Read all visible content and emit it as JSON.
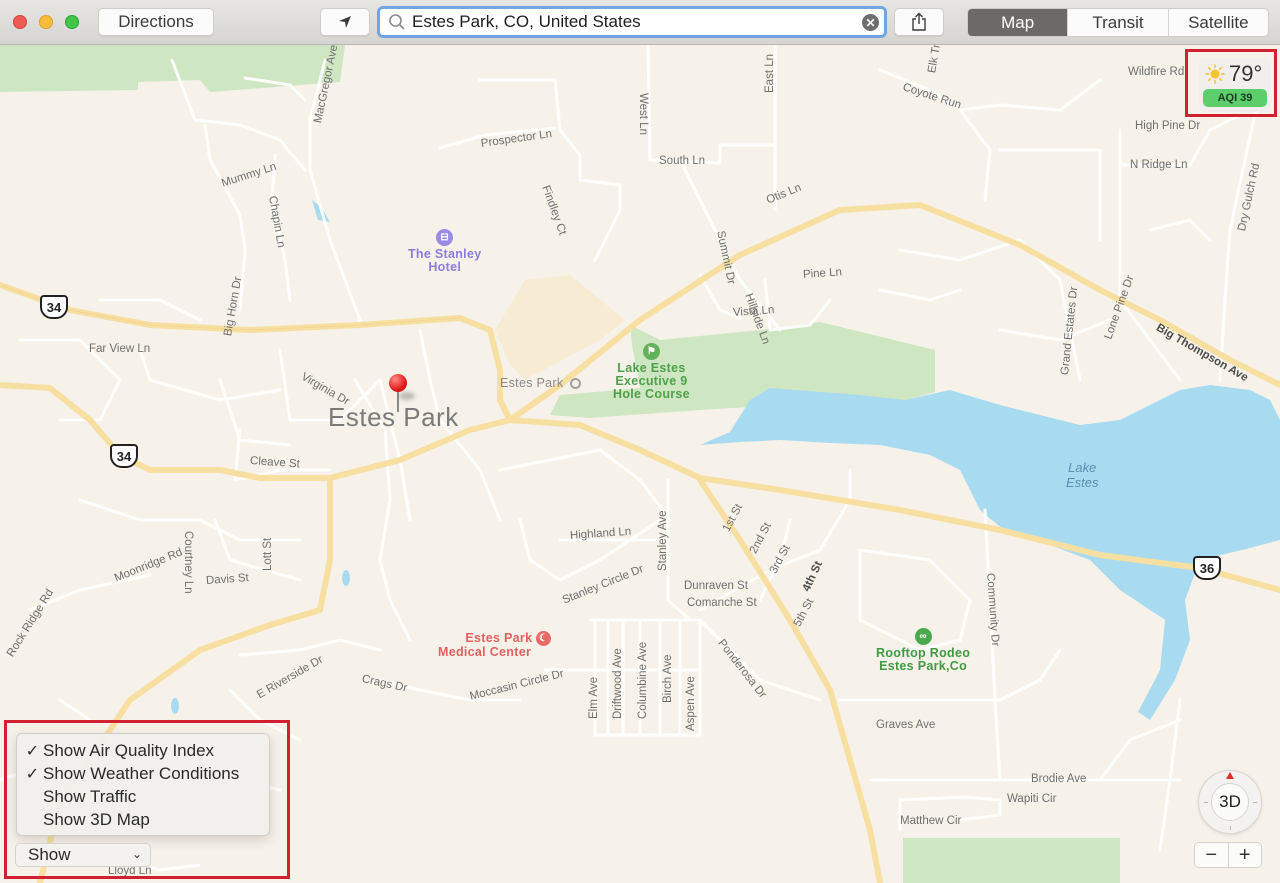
{
  "window": {
    "controls": [
      "close",
      "minimize",
      "maximize"
    ]
  },
  "toolbar": {
    "directions_label": "Directions",
    "locate_icon": "location-arrow-icon",
    "search": {
      "value": "Estes Park, CO, United States",
      "icon": "search-icon",
      "clear_icon": "clear-icon",
      "clear_glyph": "✕"
    },
    "share_icon": "share-icon",
    "map_modes": [
      {
        "label": "Map",
        "active": true
      },
      {
        "label": "Transit",
        "active": false
      },
      {
        "label": "Satellite",
        "active": false
      }
    ]
  },
  "weather": {
    "icon": "sun-icon",
    "temperature": "79°",
    "aqi_label": "AQI 39",
    "aqi_color": "#5ccf6c"
  },
  "map": {
    "city_label": "Estes Park",
    "pin_color": "#e01c1c",
    "lake_label": [
      "Lake",
      "Estes"
    ],
    "highway_shields": [
      {
        "number": "34"
      },
      {
        "number": "34"
      },
      {
        "number": "36"
      }
    ],
    "pois": [
      {
        "name_lines": [
          "The Stanley",
          "Hotel"
        ],
        "icon": "hotel-icon",
        "color": "#8b7ddb"
      },
      {
        "name_lines": [
          "Lake Estes",
          "Executive 9",
          "Hole Course"
        ],
        "icon": "golf-icon",
        "color": "#4ea04a"
      },
      {
        "name_lines": [
          "Estes Park",
          "Medical Center"
        ],
        "icon": "hospital-icon",
        "color": "#e2605f"
      },
      {
        "name_lines": [
          "Rooftop Rodeo",
          "Estes Park,Co"
        ],
        "icon": "amusement-icon",
        "color": "#3f9a42"
      },
      {
        "name_lines": [
          "Estes Park"
        ],
        "icon": "town-icon",
        "color": "#8a8a8a"
      }
    ],
    "street_labels": [
      "MacGregor Ave",
      "West Ln",
      "East Ln",
      "Elk Tr",
      "Coyote Run",
      "Wildfire Rd",
      "High Pine Dr",
      "Prospector Ln",
      "South Ln",
      "Mummy Ln",
      "Chapin Ln",
      "Findley Ct",
      "Summit Dr",
      "Otis Ln",
      "N Ridge Ln",
      "Dry Gulch Rd",
      "Big Horn Dr",
      "Hillside Ln",
      "Pine Ln",
      "Lone Pine Dr",
      "Grand Estates Dr",
      "Vista Ln",
      "Big Thompson Ave",
      "Far View Ln",
      "Virginia Dr",
      "Cleave St",
      "Highland Ln",
      "Stanley Ave",
      "1st St",
      "2nd St",
      "3rd St",
      "4th St",
      "5th St",
      "Moonridge Rd",
      "Courtney Ln",
      "Lott St",
      "Davis St",
      "Stanley Circle Dr",
      "Dunraven St",
      "Comanche St",
      "Rock Ridge Rd",
      "Community Dr",
      "E Riverside Dr",
      "Crags Dr",
      "Moccasin Circle Dr",
      "Elm Ave",
      "Driftwood Ave",
      "Columbine Ave",
      "Birch Ave",
      "Aspen Ave",
      "Ponderosa Dr",
      "Graves Ave",
      "Brodie Ave",
      "Wapiti Cir",
      "Matthew Cir",
      "Lloyd Ln"
    ]
  },
  "show_menu": {
    "items": [
      {
        "label": "Show Air Quality Index",
        "checked": true,
        "check_glyph": "✓"
      },
      {
        "label": "Show Weather Conditions",
        "checked": true,
        "check_glyph": "✓"
      },
      {
        "label": "Show Traffic",
        "checked": false,
        "check_glyph": ""
      },
      {
        "label": "Show 3D Map",
        "checked": false,
        "check_glyph": ""
      }
    ],
    "select_value": "Show",
    "select_chevron": "⌄"
  },
  "controls": {
    "compass_label": "3D",
    "zoom_out": "−",
    "zoom_in": "+"
  }
}
